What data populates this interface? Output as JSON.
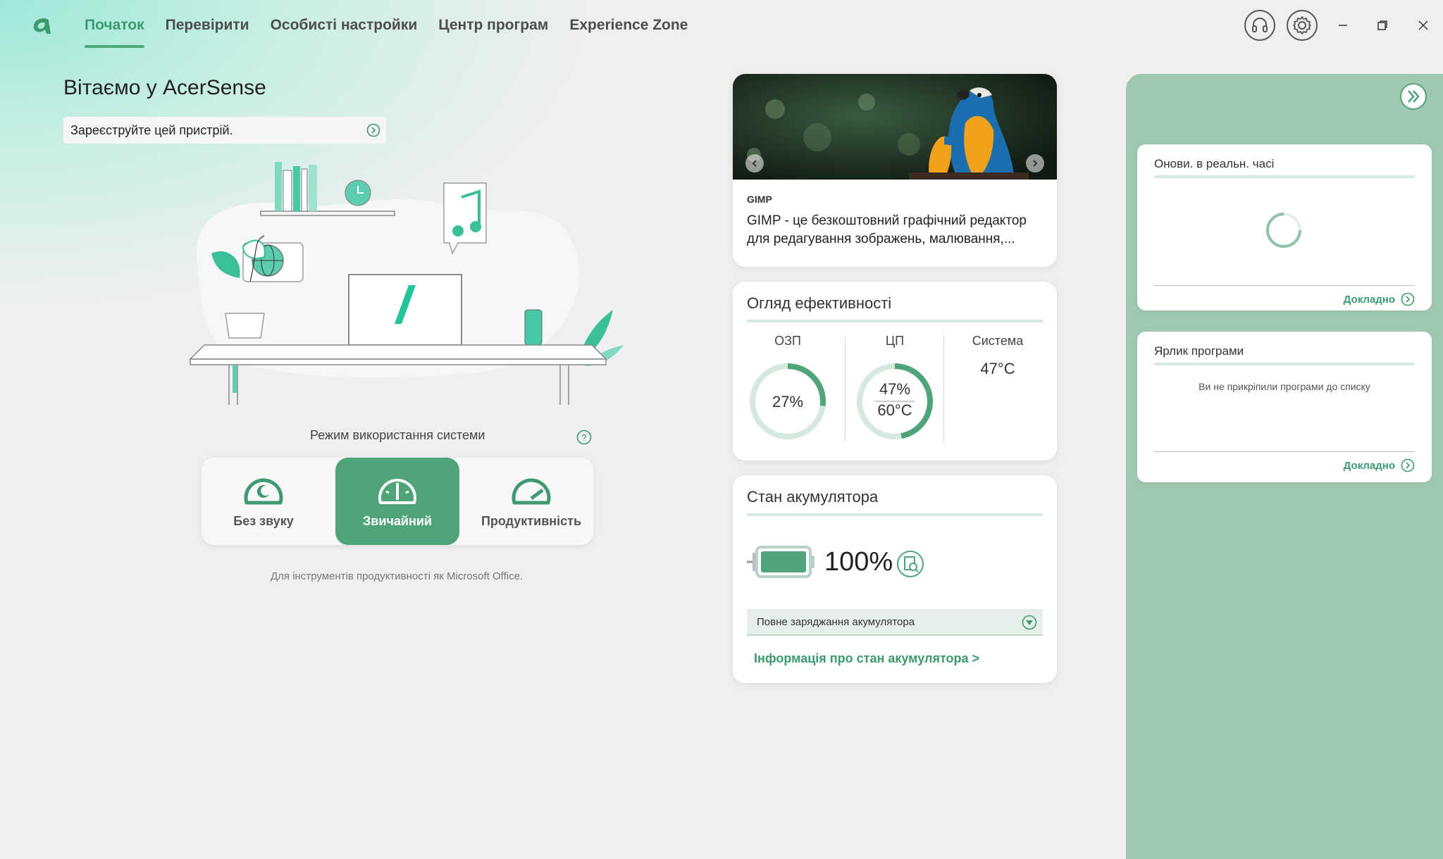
{
  "nav": {
    "items": [
      "Початок",
      "Перевірити",
      "Особисті настройки",
      "Центр програм",
      "Experience Zone"
    ],
    "active": 0
  },
  "home": {
    "welcome": "Вітаємо у AcerSense",
    "register": "Зареєструйте цей пристрій.",
    "mode_title": "Режим використання системи",
    "modes": [
      "Без звуку",
      "Звичайний",
      "Продуктивність"
    ],
    "active_mode": 1,
    "mode_desc": "Для інструментів продуктивності як Microsoft Office."
  },
  "promo": {
    "tag": "GIMP",
    "desc": "GIMP - це безкоштовний графічний редактор для редагування зображень, малювання,..."
  },
  "perf": {
    "title": "Огляд ефективності",
    "ram_label": "ОЗП",
    "ram_value": "27%",
    "ram_fraction": 0.27,
    "cpu_label": "ЦП",
    "cpu_value": "47%",
    "cpu_temp": "60°C",
    "cpu_fraction": 0.47,
    "system_label": "Система",
    "system_temp": "47°C"
  },
  "battery": {
    "title": "Стан акумулятора",
    "percent": "100%",
    "level": 1.0,
    "mode": "Повне заряджання акумулятора",
    "link": "Інформація про стан акумулятора >"
  },
  "right": {
    "realtime_title": "Онови. в реальн. часі",
    "realtime_more": "Докладно",
    "shortcut_title": "Ярлик програми",
    "shortcut_empty": "Ви не прикріпили програми до списку",
    "shortcut_more": "Докладно"
  },
  "colors": {
    "accent": "#4fa47a",
    "panel": "#9fc8b0"
  }
}
